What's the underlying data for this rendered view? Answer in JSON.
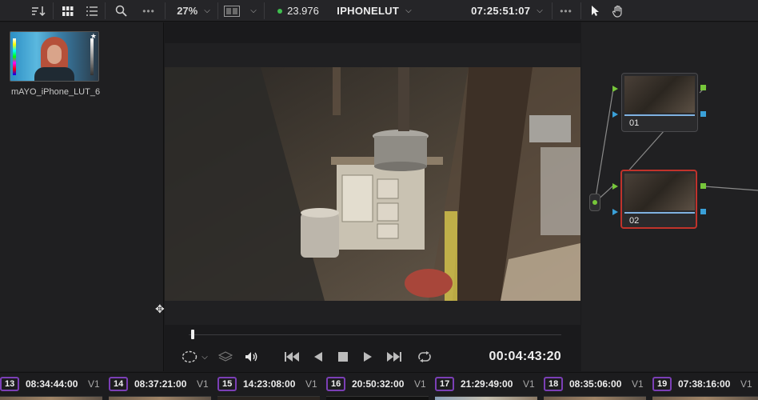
{
  "toolbar": {
    "zoom": "27%",
    "fps": "23.976",
    "project_title": "IPHONELUT",
    "timecode": "07:25:51:07"
  },
  "media_pool": {
    "clip_name": "mAYO_iPhone_LUT_6"
  },
  "viewer": {
    "timecode": "00:04:43:20",
    "playhead_fraction": 0.01
  },
  "nodes": [
    {
      "label": "01"
    },
    {
      "label": "02"
    }
  ],
  "timeline": {
    "clips": [
      {
        "num": "13",
        "tc": "08:34:44:00",
        "track": "V1"
      },
      {
        "num": "14",
        "tc": "08:37:21:00",
        "track": "V1"
      },
      {
        "num": "15",
        "tc": "14:23:08:00",
        "track": "V1"
      },
      {
        "num": "16",
        "tc": "20:50:32:00",
        "track": "V1"
      },
      {
        "num": "17",
        "tc": "21:29:49:00",
        "track": "V1"
      },
      {
        "num": "18",
        "tc": "08:35:06:00",
        "track": "V1"
      },
      {
        "num": "19",
        "tc": "07:38:16:00",
        "track": "V1"
      }
    ]
  },
  "colors": {
    "accent_green": "#3fbf4f",
    "node_selected": "#c0332b",
    "clip_outline": "#7b3fb6"
  },
  "icons": [
    "sort-icon",
    "grid-view-icon",
    "list-view-icon",
    "search-icon",
    "more-icon",
    "viewer-layout-icon",
    "pointer-icon",
    "hand-icon",
    "move-cursor-icon",
    "power-window-icon",
    "layers-icon",
    "volume-icon",
    "skip-back-icon",
    "reverse-icon",
    "stop-icon",
    "play-icon",
    "skip-forward-icon",
    "loop-icon"
  ]
}
